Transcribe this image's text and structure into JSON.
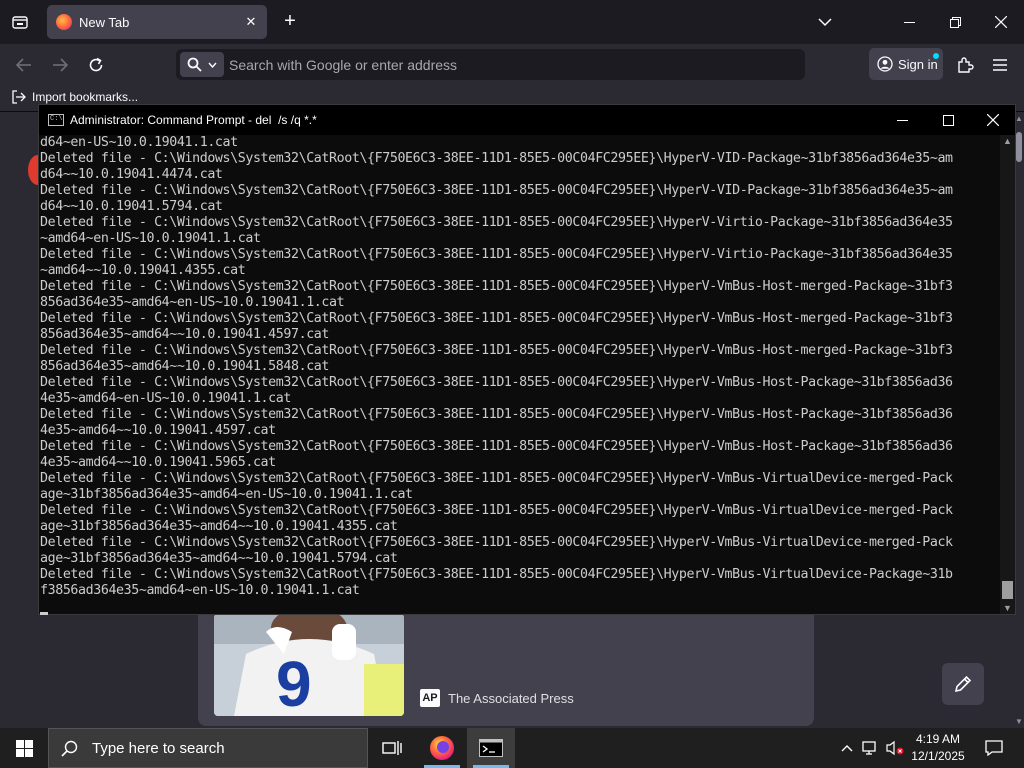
{
  "browser": {
    "tab": {
      "title": "New Tab",
      "close": "✕"
    },
    "new_tab": "+",
    "address_placeholder": "Search with Google or enter address",
    "sign_in": "Sign in",
    "bookmarks": {
      "import": "Import bookmarks..."
    },
    "accent": "#00ddff"
  },
  "newtab": {
    "story_source": "The Associated Press",
    "source_logo": "AP",
    "jersey_number": "9"
  },
  "cmd": {
    "title": "Administrator: Command Prompt - del  /s /q *.*",
    "lines": [
      "d64~en-US~10.0.19041.1.cat",
      "Deleted file - C:\\Windows\\System32\\CatRoot\\{F750E6C3-38EE-11D1-85E5-00C04FC295EE}\\HyperV-VID-Package~31bf3856ad364e35~am",
      "d64~~10.0.19041.4474.cat",
      "Deleted file - C:\\Windows\\System32\\CatRoot\\{F750E6C3-38EE-11D1-85E5-00C04FC295EE}\\HyperV-VID-Package~31bf3856ad364e35~am",
      "d64~~10.0.19041.5794.cat",
      "Deleted file - C:\\Windows\\System32\\CatRoot\\{F750E6C3-38EE-11D1-85E5-00C04FC295EE}\\HyperV-Virtio-Package~31bf3856ad364e35",
      "~amd64~en-US~10.0.19041.1.cat",
      "Deleted file - C:\\Windows\\System32\\CatRoot\\{F750E6C3-38EE-11D1-85E5-00C04FC295EE}\\HyperV-Virtio-Package~31bf3856ad364e35",
      "~amd64~~10.0.19041.4355.cat",
      "Deleted file - C:\\Windows\\System32\\CatRoot\\{F750E6C3-38EE-11D1-85E5-00C04FC295EE}\\HyperV-VmBus-Host-merged-Package~31bf3",
      "856ad364e35~amd64~en-US~10.0.19041.1.cat",
      "Deleted file - C:\\Windows\\System32\\CatRoot\\{F750E6C3-38EE-11D1-85E5-00C04FC295EE}\\HyperV-VmBus-Host-merged-Package~31bf3",
      "856ad364e35~amd64~~10.0.19041.4597.cat",
      "Deleted file - C:\\Windows\\System32\\CatRoot\\{F750E6C3-38EE-11D1-85E5-00C04FC295EE}\\HyperV-VmBus-Host-merged-Package~31bf3",
      "856ad364e35~amd64~~10.0.19041.5848.cat",
      "Deleted file - C:\\Windows\\System32\\CatRoot\\{F750E6C3-38EE-11D1-85E5-00C04FC295EE}\\HyperV-VmBus-Host-Package~31bf3856ad36",
      "4e35~amd64~en-US~10.0.19041.1.cat",
      "Deleted file - C:\\Windows\\System32\\CatRoot\\{F750E6C3-38EE-11D1-85E5-00C04FC295EE}\\HyperV-VmBus-Host-Package~31bf3856ad36",
      "4e35~amd64~~10.0.19041.4597.cat",
      "Deleted file - C:\\Windows\\System32\\CatRoot\\{F750E6C3-38EE-11D1-85E5-00C04FC295EE}\\HyperV-VmBus-Host-Package~31bf3856ad36",
      "4e35~amd64~~10.0.19041.5965.cat",
      "Deleted file - C:\\Windows\\System32\\CatRoot\\{F750E6C3-38EE-11D1-85E5-00C04FC295EE}\\HyperV-VmBus-VirtualDevice-merged-Pack",
      "age~31bf3856ad364e35~amd64~en-US~10.0.19041.1.cat",
      "Deleted file - C:\\Windows\\System32\\CatRoot\\{F750E6C3-38EE-11D1-85E5-00C04FC295EE}\\HyperV-VmBus-VirtualDevice-merged-Pack",
      "age~31bf3856ad364e35~amd64~~10.0.19041.4355.cat",
      "Deleted file - C:\\Windows\\System32\\CatRoot\\{F750E6C3-38EE-11D1-85E5-00C04FC295EE}\\HyperV-VmBus-VirtualDevice-merged-Pack",
      "age~31bf3856ad364e35~amd64~~10.0.19041.5794.cat",
      "Deleted file - C:\\Windows\\System32\\CatRoot\\{F750E6C3-38EE-11D1-85E5-00C04FC295EE}\\HyperV-VmBus-VirtualDevice-Package~31b",
      "f3856ad364e35~amd64~en-US~10.0.19041.1.cat"
    ]
  },
  "taskbar": {
    "search_placeholder": "Type here to search",
    "time": "4:19 AM",
    "date": "12/1/2025",
    "active_color": "#76b9ed",
    "apps": [
      "task-view-icon",
      "firefox-icon",
      "command-prompt-icon"
    ],
    "tray_icons": [
      "chevron-up-icon",
      "network-icon",
      "volume-muted-icon",
      "notification-icon"
    ]
  }
}
